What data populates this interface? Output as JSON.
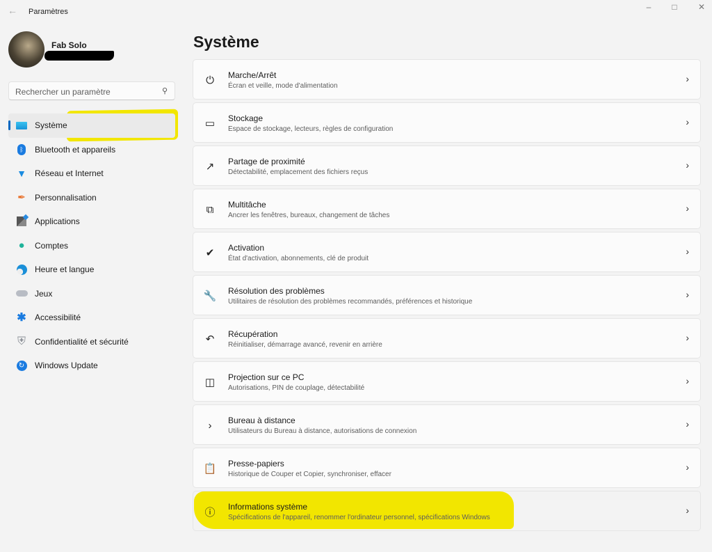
{
  "window": {
    "title": "Paramètres",
    "back_icon": "arrow-left-icon",
    "controls": [
      "minimize-icon",
      "maximize-icon",
      "close-icon"
    ]
  },
  "user": {
    "name": "Fab Solo"
  },
  "search": {
    "placeholder": "Rechercher un paramètre",
    "icon": "search-icon"
  },
  "sidebar": {
    "items": [
      {
        "label": "Système",
        "icon": "monitor-icon",
        "active": true
      },
      {
        "label": "Bluetooth et appareils",
        "icon": "bluetooth-icon"
      },
      {
        "label": "Réseau et Internet",
        "icon": "wifi-icon"
      },
      {
        "label": "Personnalisation",
        "icon": "brush-icon"
      },
      {
        "label": "Applications",
        "icon": "apps-icon"
      },
      {
        "label": "Comptes",
        "icon": "person-icon"
      },
      {
        "label": "Heure et langue",
        "icon": "globe-clock-icon"
      },
      {
        "label": "Jeux",
        "icon": "gamepad-icon"
      },
      {
        "label": "Accessibilité",
        "icon": "accessibility-icon"
      },
      {
        "label": "Confidentialité et sécurité",
        "icon": "shield-icon"
      },
      {
        "label": "Windows Update",
        "icon": "update-icon"
      }
    ]
  },
  "main": {
    "title": "Système",
    "cards": [
      {
        "title": "Marche/Arrêt",
        "subtitle": "Écran et veille, mode d'alimentation",
        "icon": "power-icon"
      },
      {
        "title": "Stockage",
        "subtitle": "Espace de stockage, lecteurs, règles de configuration",
        "icon": "storage-icon"
      },
      {
        "title": "Partage de proximité",
        "subtitle": "Détectabilité, emplacement des fichiers reçus",
        "icon": "share-icon"
      },
      {
        "title": "Multitâche",
        "subtitle": "Ancrer les fenêtres, bureaux, changement de tâches",
        "icon": "multitask-icon"
      },
      {
        "title": "Activation",
        "subtitle": "État d'activation, abonnements, clé de produit",
        "icon": "check-circle-icon"
      },
      {
        "title": "Résolution des problèmes",
        "subtitle": "Utilitaires de résolution des problèmes recommandés, préférences et historique",
        "icon": "wrench-icon"
      },
      {
        "title": "Récupération",
        "subtitle": "Réinitialiser, démarrage avancé, revenir en arrière",
        "icon": "recovery-icon"
      },
      {
        "title": "Projection sur ce PC",
        "subtitle": "Autorisations, PIN de couplage, détectabilité",
        "icon": "projection-icon"
      },
      {
        "title": "Bureau à distance",
        "subtitle": "Utilisateurs du Bureau à distance, autorisations de connexion",
        "icon": "remote-desktop-icon"
      },
      {
        "title": "Presse-papiers",
        "subtitle": "Historique de Couper et Copier, synchroniser, effacer",
        "icon": "clipboard-icon"
      },
      {
        "title": "Informations système",
        "subtitle": "Spécifications de l'appareil, renommer l'ordinateur personnel, spécifications Windows",
        "icon": "info-icon"
      }
    ]
  },
  "colors": {
    "accent": "#0067c0",
    "highlight": "#f2e600"
  }
}
